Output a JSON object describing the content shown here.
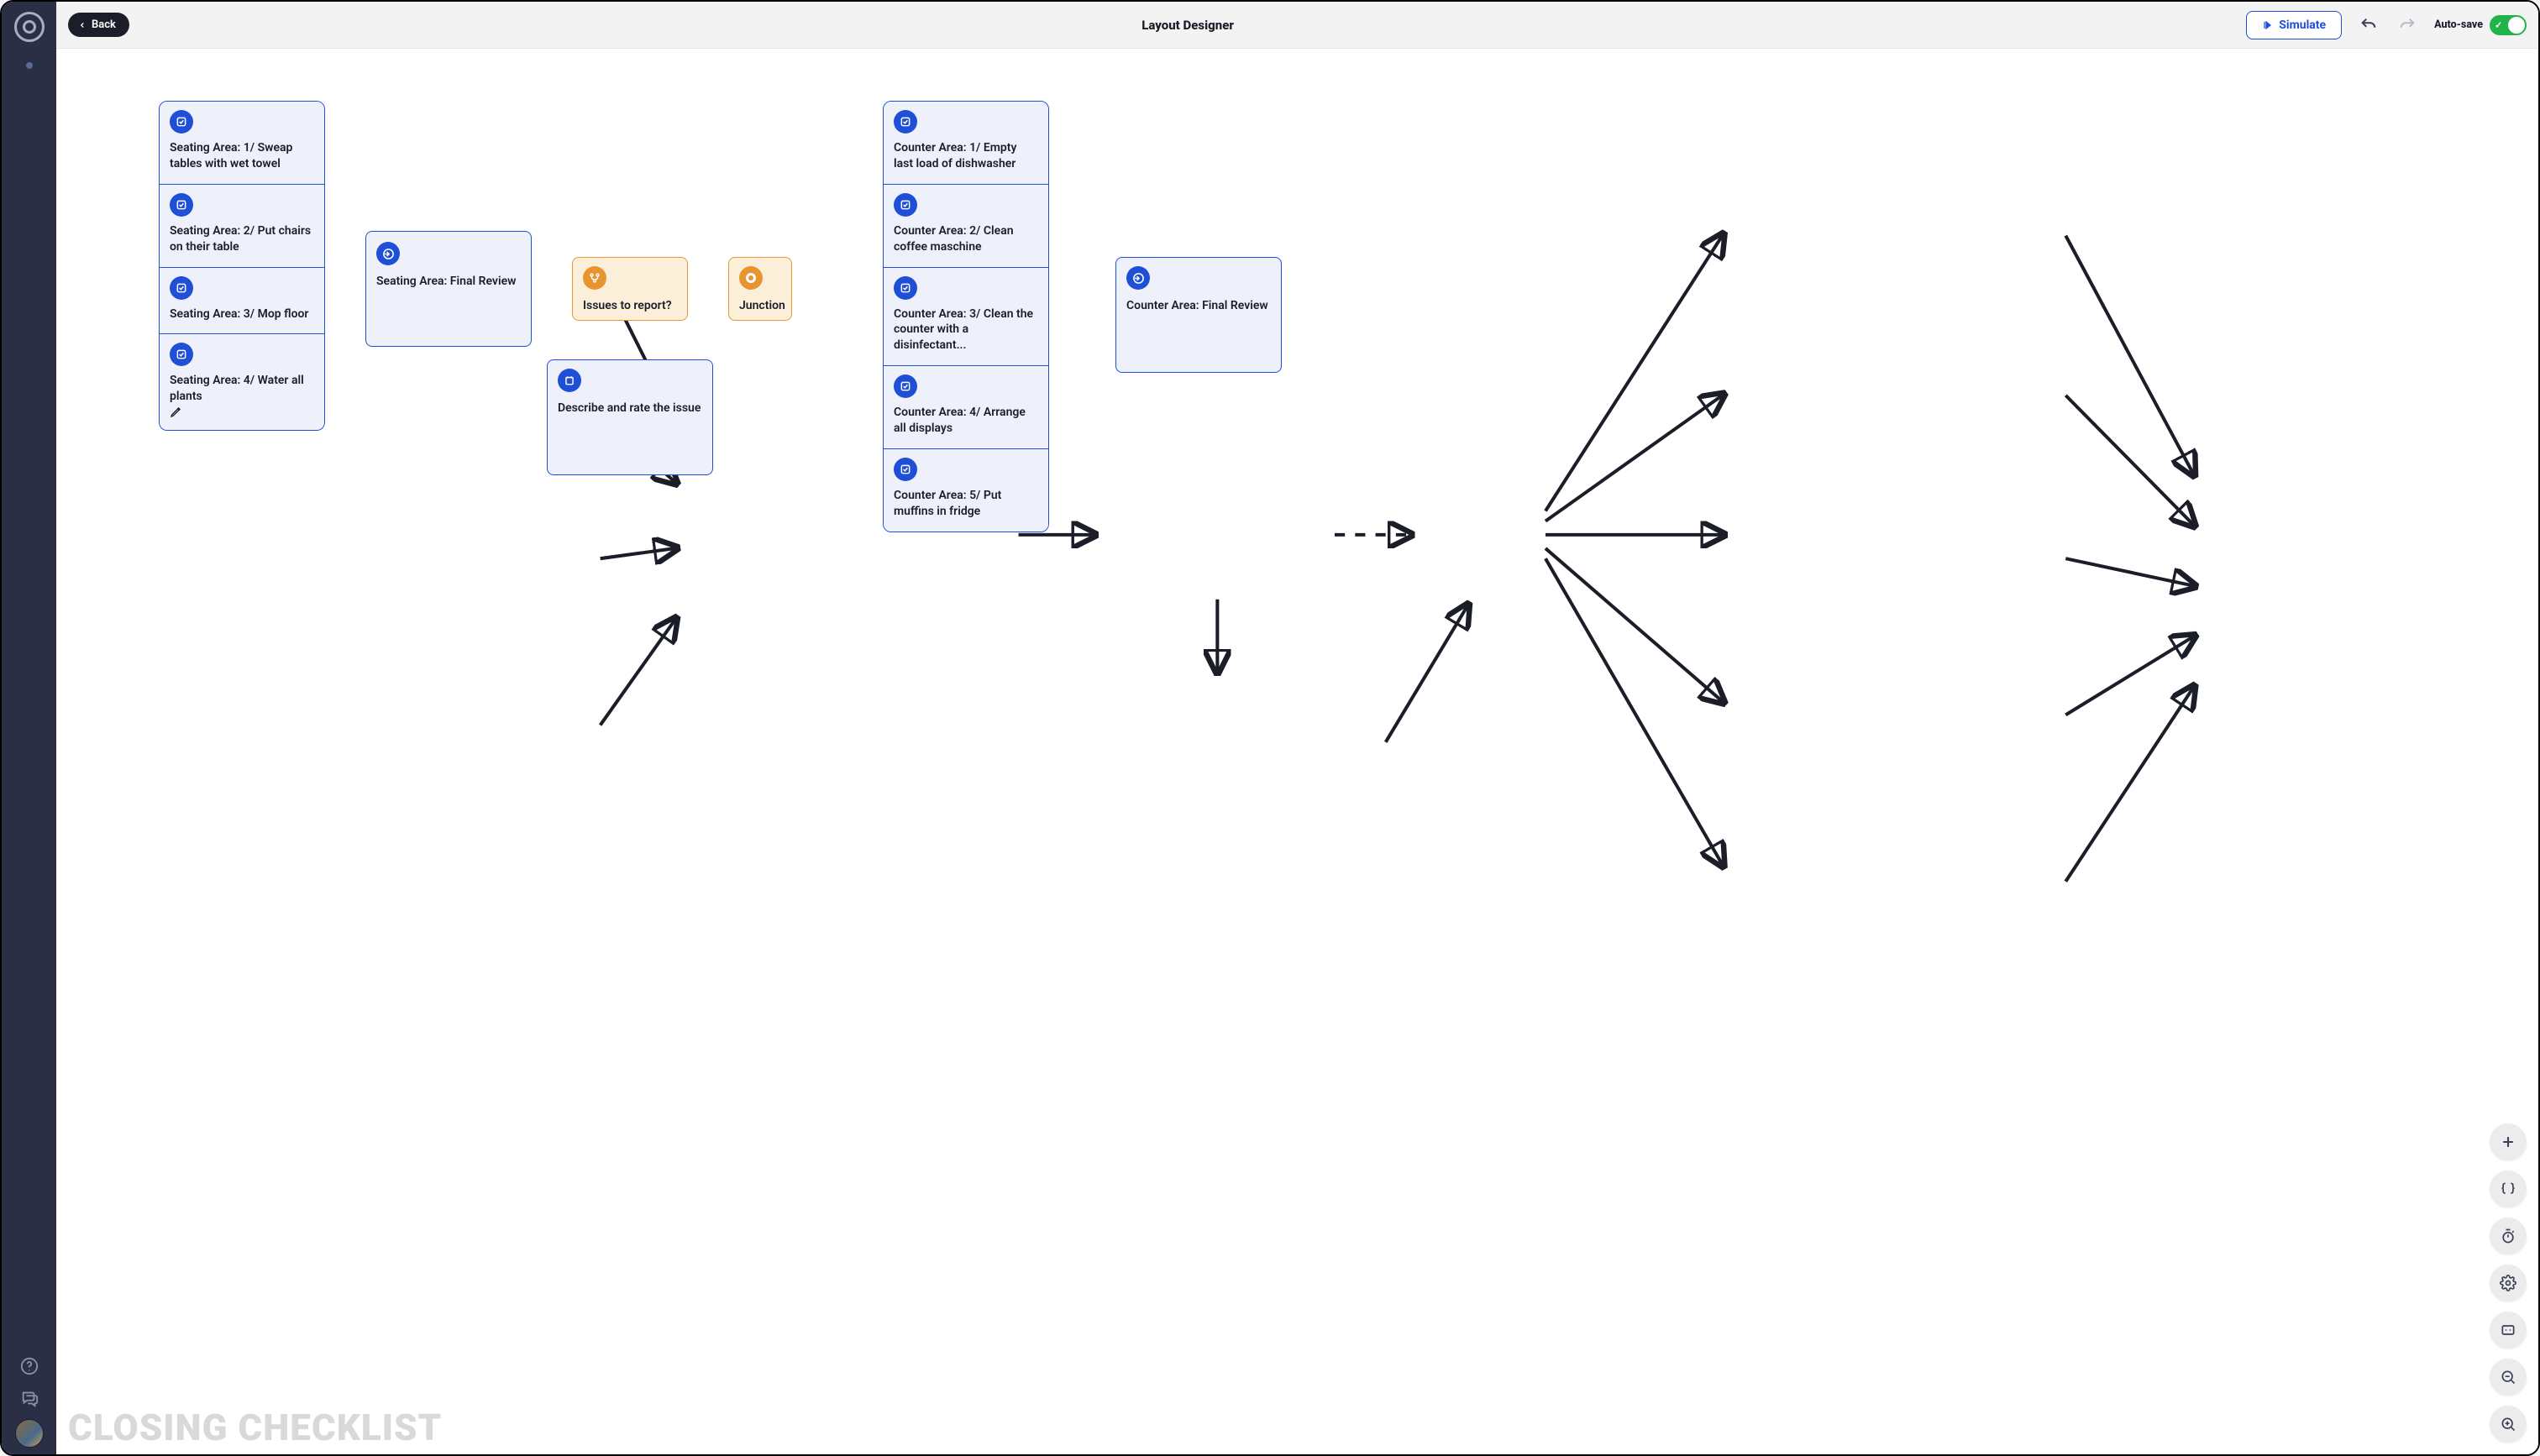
{
  "header": {
    "back_label": "Back",
    "title": "Layout Designer",
    "simulate_label": "Simulate",
    "autosave_label": "Auto-save"
  },
  "watermark": "CLOSING CHECKLIST",
  "nodes": {
    "left_tasks": [
      {
        "text": "Seating Area: 1/ Sweap tables with wet towel"
      },
      {
        "text": "Seating Area: 2/ Put chairs on their table"
      },
      {
        "text": "Seating Area: 3/ Mop floor"
      },
      {
        "text": "Seating Area: 4/ Water all plants",
        "has_pen": true
      }
    ],
    "final_left": "Seating Area: Final Review",
    "issues": "Issues to report?",
    "junction": "Junction",
    "describe": "Describe and rate the issue",
    "right_tasks": [
      {
        "text": "Counter Area: 1/ Empty last load of dishwasher"
      },
      {
        "text": "Counter Area: 2/ Clean coffee maschine"
      },
      {
        "text": "Counter Area: 3/ Clean the counter with a disinfectant..."
      },
      {
        "text": "Counter Area: 4/ Arrange all displays"
      },
      {
        "text": "Counter Area: 5/ Put muffins in fridge"
      }
    ],
    "final_right": "Counter Area: Final Review"
  },
  "tools": [
    "add",
    "braces",
    "timer",
    "settings",
    "fit",
    "zoom-out",
    "zoom-in"
  ]
}
